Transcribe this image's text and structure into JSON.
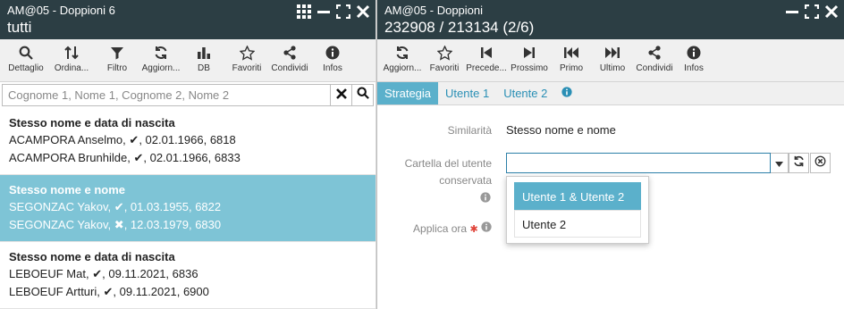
{
  "left": {
    "subtitle": "AM@05 - Doppioni 6",
    "title": "tutti",
    "toolbar": [
      {
        "label": "Dettaglio",
        "icon": "search-icon"
      },
      {
        "label": "Ordina...",
        "icon": "sort-icon"
      },
      {
        "label": "Filtro",
        "icon": "filter-icon"
      },
      {
        "label": "Aggiorn...",
        "icon": "refresh-icon"
      },
      {
        "label": "DB",
        "icon": "bar-chart-icon"
      },
      {
        "label": "Favoriti",
        "icon": "star-icon"
      },
      {
        "label": "Condividi",
        "icon": "share-icon"
      },
      {
        "label": "Infos",
        "icon": "info-icon"
      }
    ],
    "search_placeholder": "Cognome 1, Nome 1, Cognome 2, Nome 2",
    "groups": [
      {
        "title": "Stesso nome e data di nascita",
        "rows": [
          {
            "name": "ACAMPORA Anselmo,",
            "mark": "✔",
            "rest": ", 02.01.1966, 6818"
          },
          {
            "name": "ACAMPORA Brunhilde,",
            "mark": "✔",
            "rest": ", 02.01.1966, 6833"
          }
        ]
      },
      {
        "title": "Stesso nome e nome",
        "rows": [
          {
            "name": "SEGONZAC Yakov,",
            "mark": "✔",
            "rest": ", 01.03.1955, 6822"
          },
          {
            "name": "SEGONZAC Yakov,",
            "mark": "✖",
            "rest": ", 12.03.1979, 6830"
          }
        ]
      },
      {
        "title": "Stesso nome e data di nascita",
        "rows": [
          {
            "name": "LEBOEUF Mat,",
            "mark": "✔",
            "rest": ", 09.11.2021, 6836"
          },
          {
            "name": "LEBOEUF Artturi,",
            "mark": "✔",
            "rest": ", 09.11.2021, 6900"
          }
        ]
      }
    ]
  },
  "right": {
    "subtitle": "AM@05 - Doppioni",
    "title": "232908 / 213134 (2/6)",
    "toolbar": [
      {
        "label": "Aggiorn...",
        "icon": "refresh-icon"
      },
      {
        "label": "Favoriti",
        "icon": "star-icon"
      },
      {
        "label": "Precede...",
        "icon": "step-back-icon"
      },
      {
        "label": "Prossimo",
        "icon": "step-forward-icon"
      },
      {
        "label": "Primo",
        "icon": "fast-backward-icon"
      },
      {
        "label": "Ultimo",
        "icon": "fast-forward-icon"
      },
      {
        "label": "Condividi",
        "icon": "share-icon"
      },
      {
        "label": "Infos",
        "icon": "info-icon"
      }
    ],
    "tabs": [
      "Strategia",
      "Utente 1",
      "Utente 2"
    ],
    "form": {
      "similarity_label": "Similarità",
      "similarity_value": "Stesso nome e nome",
      "folder_label_1": "Cartella del utente",
      "folder_label_2": "conservata",
      "apply_label": "Applica ora",
      "required_mark": "✱",
      "options": [
        "Utente 1 & Utente 2",
        "Utente 2"
      ]
    }
  },
  "colors": {
    "header": "#2c3e44",
    "accent": "#5bb0cb",
    "selected_row": "#7ec4d6",
    "link": "#2a8fb5",
    "required": "#e0443a"
  }
}
